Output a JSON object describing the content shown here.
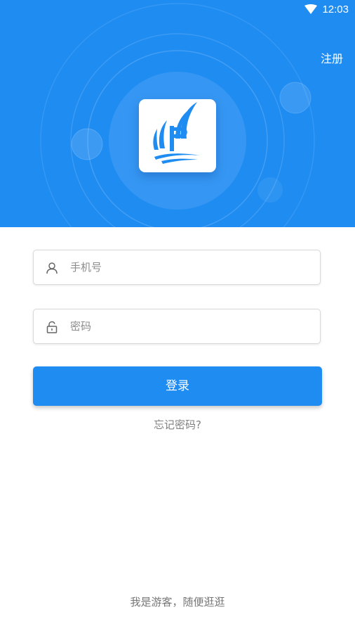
{
  "status_bar": {
    "time": "12:03",
    "wifi_icon": "wifi-icon"
  },
  "header": {
    "register_label": "注册",
    "logo_icon": "app-logo-icon",
    "background_color": "#1f8cf2"
  },
  "form": {
    "phone": {
      "placeholder": "手机号",
      "value": "",
      "icon": "user-icon"
    },
    "password": {
      "placeholder": "密码",
      "value": "",
      "icon": "lock-icon"
    },
    "login_label": "登录",
    "forgot_label": "忘记密码?"
  },
  "footer": {
    "guest_label": "我是游客，随便逛逛"
  },
  "colors": {
    "primary": "#1f8cf2",
    "muted_text": "#808080",
    "border": "#d9d9d9"
  }
}
